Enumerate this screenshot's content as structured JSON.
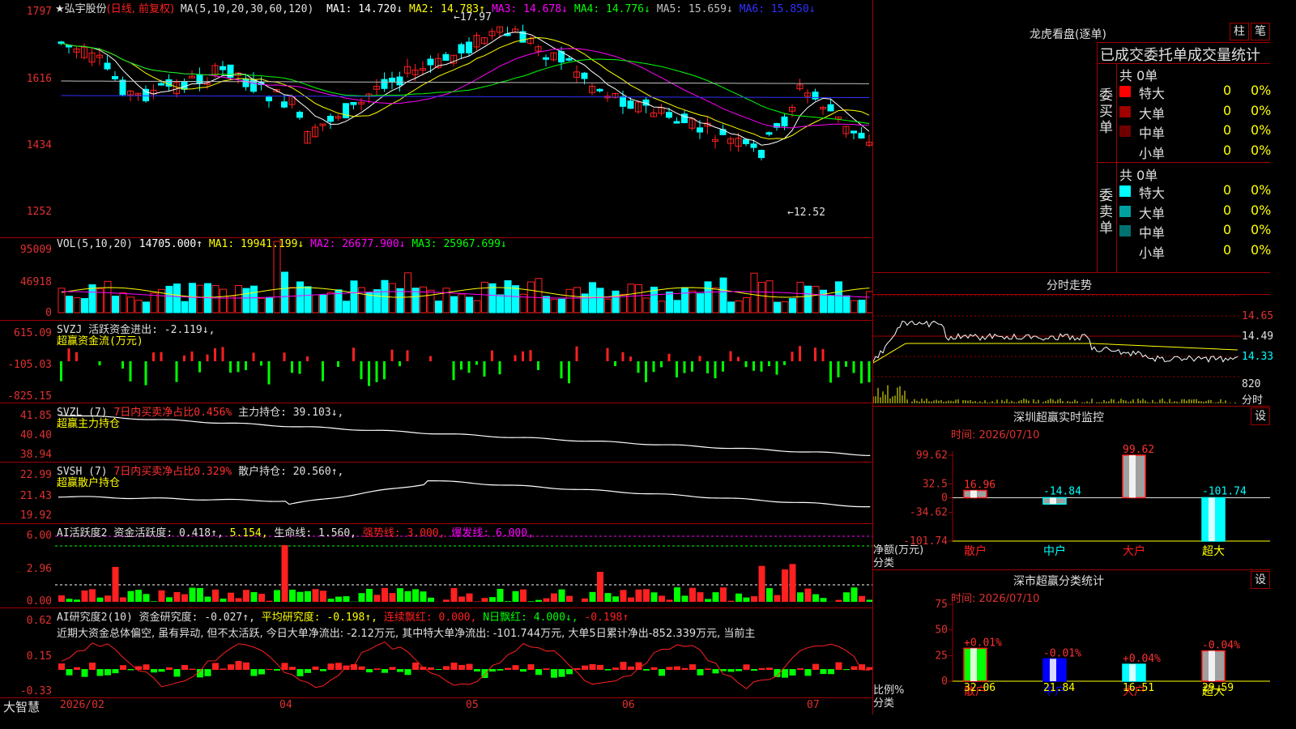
{
  "main": {
    "price_labels": [
      "1797",
      "1616",
      "1434",
      "1252"
    ],
    "stock_name": "★弘宇股份",
    "mode": "(日线, 前复权)",
    "ma_params": "MA(5,10,20,30,60,120)",
    "ma_items": [
      {
        "text": "MA1: 14.720↓",
        "color": "#ffffff"
      },
      {
        "text": "MA2: 14.783↑",
        "color": "#ffff00"
      },
      {
        "text": "MA3: 14.678↓",
        "color": "#ff00ff"
      },
      {
        "text": "MA4: 14.776↓",
        "color": "#00ff00"
      },
      {
        "text": "MA5: 15.659↓",
        "color": "#c0c0c0"
      },
      {
        "text": "MA6: 15.850↓",
        "color": "#3030ff"
      }
    ],
    "high_label": "←17.97",
    "low_label": "←12.52"
  },
  "vol": {
    "axis": [
      "95009",
      "46918",
      "0"
    ],
    "header": "VOL(5,10,20)",
    "value": "14705.000↑",
    "ma1": "MA1: 19941.199↓",
    "ma2": "MA2: 26677.900↓",
    "ma3": "MA3: 25967.699↓"
  },
  "svzj": {
    "axis": [
      "615.09",
      "-105.03",
      "-825.15"
    ],
    "title": "SVZJ  活跃资金进出: -2.119↓,",
    "subtitle": "超赢资金流(万元)"
  },
  "svzl": {
    "axis": [
      "41.85",
      "40.40",
      "38.94"
    ],
    "name": "SVZL (7)",
    "ratio": "7日内买卖净占比0.456%",
    "hold": "主力持仓: 39.103↓,",
    "subtitle": "超赢主力持仓"
  },
  "svsh": {
    "axis": [
      "22.99",
      "21.43",
      "19.92"
    ],
    "name": "SVSH (7)",
    "ratio": "7日内买卖净占比0.329%",
    "hold": "散户持仓: 20.560↑,",
    "subtitle": "超赢散户持仓"
  },
  "ai_active": {
    "axis": [
      "6.00",
      "2.96",
      "0.00"
    ],
    "name": "AI活跃度2",
    "d1": "资金活跃度: 0.418↑,",
    "d2": "5.154,",
    "d3": "生命线: 1.560,",
    "d4": "强势线: 3.000,",
    "d5": "爆发线: 6.000,"
  },
  "ai_research": {
    "axis": [
      "0.62",
      "0.15",
      "-0.33"
    ],
    "name": "AI研究度2(10)",
    "d1": "资金研究度: -0.027↑,",
    "d2": "平均研究度: -0.198↑,",
    "d3": "连续飘红: 0.000,",
    "d4": "N日飘红: 4.000↓,",
    "d5": "-0.198↑",
    "comment": "近期大资金总体偏空, 虽有异动, 但不太活跃, 今日大单净流出: -2.12万元, 其中特大单净流出: -101.744万元, 大单5日累计净出-852.339万元, 当前主"
  },
  "x_axis": {
    "brand": "大智慧",
    "labels": [
      "2026/02",
      "04",
      "05",
      "06",
      "07"
    ]
  },
  "dragon": {
    "title": "龙虎看盘(逐单)",
    "btn1": "柱",
    "btn2": "笔",
    "header": "已成交委托单成交量统计",
    "buy_label": "委买单",
    "sell_label": "委卖单",
    "buy_total": "共 0单",
    "sell_total": "共 0单",
    "buy_rows": [
      {
        "name": "特大",
        "val": "0",
        "pct": "0%",
        "color": "#ff0000"
      },
      {
        "name": "大单",
        "val": "0",
        "pct": "0%",
        "color": "#a00000"
      },
      {
        "name": "中单",
        "val": "0",
        "pct": "0%",
        "color": "#700000"
      },
      {
        "name": "小单",
        "val": "0",
        "pct": "0%",
        "color": ""
      }
    ],
    "sell_rows": [
      {
        "name": "特大",
        "val": "0",
        "pct": "0%",
        "color": "#00ffff"
      },
      {
        "name": "大单",
        "val": "0",
        "pct": "0%",
        "color": "#00a0a0"
      },
      {
        "name": "中单",
        "val": "0",
        "pct": "0%",
        "color": "#007070"
      },
      {
        "name": "小单",
        "val": "0",
        "pct": "0%",
        "color": ""
      }
    ]
  },
  "intraday": {
    "title": "分时走势",
    "right_labels": [
      "14.65",
      "14.49",
      "14.33",
      "820"
    ],
    "settings": "分时"
  },
  "sz_monitor": {
    "title": "深圳超赢实时监控",
    "settings": "设",
    "time": "时间: 2026/07/10",
    "axis": [
      "99.62",
      "32.5",
      "0",
      "-34.62",
      "-101.74"
    ],
    "y_title1": "净额(万元)",
    "y_title2": "分类",
    "categories": [
      "散户",
      "中户",
      "大户",
      "超大"
    ],
    "value_labels": [
      "16.96",
      "-14.84",
      "99.62",
      "-101.74"
    ]
  },
  "sz_class": {
    "title": "深市超赢分类统计",
    "settings": "设",
    "time": "时间: 2026/07/10",
    "axis": [
      "75",
      "50",
      "25",
      "0"
    ],
    "y_title1": "比例%",
    "y_title2": "分类",
    "categories": [
      "散户",
      "中户",
      "大户",
      "超大"
    ],
    "top_labels": [
      "+0.01%",
      "-0.01%",
      "+0.04%",
      "-0.04%"
    ],
    "bottom_labels": [
      "32.06",
      "21.84",
      "16.51",
      "29.59"
    ]
  },
  "chart_data": [
    {
      "type": "bar",
      "title": "深圳超赢实时监控",
      "categories": [
        "散户",
        "中户",
        "大户",
        "超大"
      ],
      "values": [
        16.96,
        -14.84,
        99.62,
        -101.74
      ],
      "ylabel": "净额(万元)",
      "ylim": [
        -101.74,
        99.62
      ]
    },
    {
      "type": "bar",
      "title": "深市超赢分类统计",
      "categories": [
        "散户",
        "中户",
        "大户",
        "超大"
      ],
      "values": [
        32.06,
        21.84,
        16.51,
        29.59
      ],
      "ylabel": "比例%",
      "ylim": [
        0,
        75
      ]
    }
  ]
}
